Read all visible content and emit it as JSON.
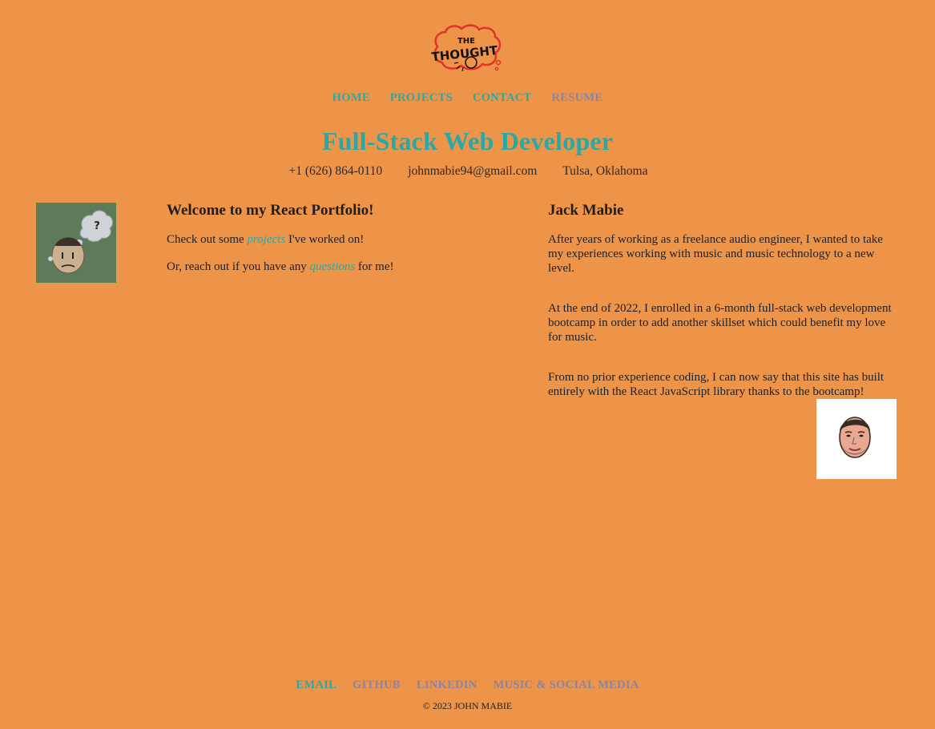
{
  "header": {
    "logo_text": "THE THOUGHT",
    "nav": [
      {
        "label": "HOME",
        "visited": false
      },
      {
        "label": "PROJECTS",
        "visited": false
      },
      {
        "label": "CONTACT",
        "visited": false
      },
      {
        "label": "RESUME",
        "visited": true
      }
    ],
    "headline": "Full-Stack Web Developer",
    "contact": {
      "phone": "+1 (626) 864-0110",
      "email": "johnmabie94@gmail.com",
      "location": "Tulsa, Oklahoma"
    }
  },
  "welcome": {
    "title": "Welcome to my React Portfolio!",
    "line1_before": "Check out some ",
    "line1_link": "projects",
    "line1_after": " I've worked on!",
    "line2_before": "Or, reach out if you have any ",
    "line2_link": "questions",
    "line2_after": " for me!"
  },
  "about": {
    "name": "Jack Mabie",
    "paragraphs": [
      "After years of working as a freelance audio engineer, I wanted to take my experiences working with music and music technology to a new level.",
      "At the end of 2022, I enrolled in a 6-month full-stack web development bootcamp in order to add another skillset which could benefit my love for music.",
      "From no prior experience coding, I can now say that this site has built entirely with the React JavaScript library thanks to the bootcamp!"
    ]
  },
  "footer": {
    "links": [
      {
        "label": "EMAIL",
        "accent": true
      },
      {
        "label": "GITHUB",
        "accent": false
      },
      {
        "label": "LINKEDIN",
        "accent": false
      },
      {
        "label": "MUSIC & SOCIAL MEDIA",
        "accent": false
      }
    ],
    "copyright": "© 2023 JOHN MABIE"
  },
  "colors": {
    "background": "#ee9449",
    "accent_teal": "#29a9a6",
    "visited_link": "#8c84a0",
    "text": "#1f1f1f"
  },
  "icons": {
    "logo": "thought-bubble-logo-icon",
    "avatar": "thinking-head-icon",
    "portrait": "face-portrait-icon"
  }
}
